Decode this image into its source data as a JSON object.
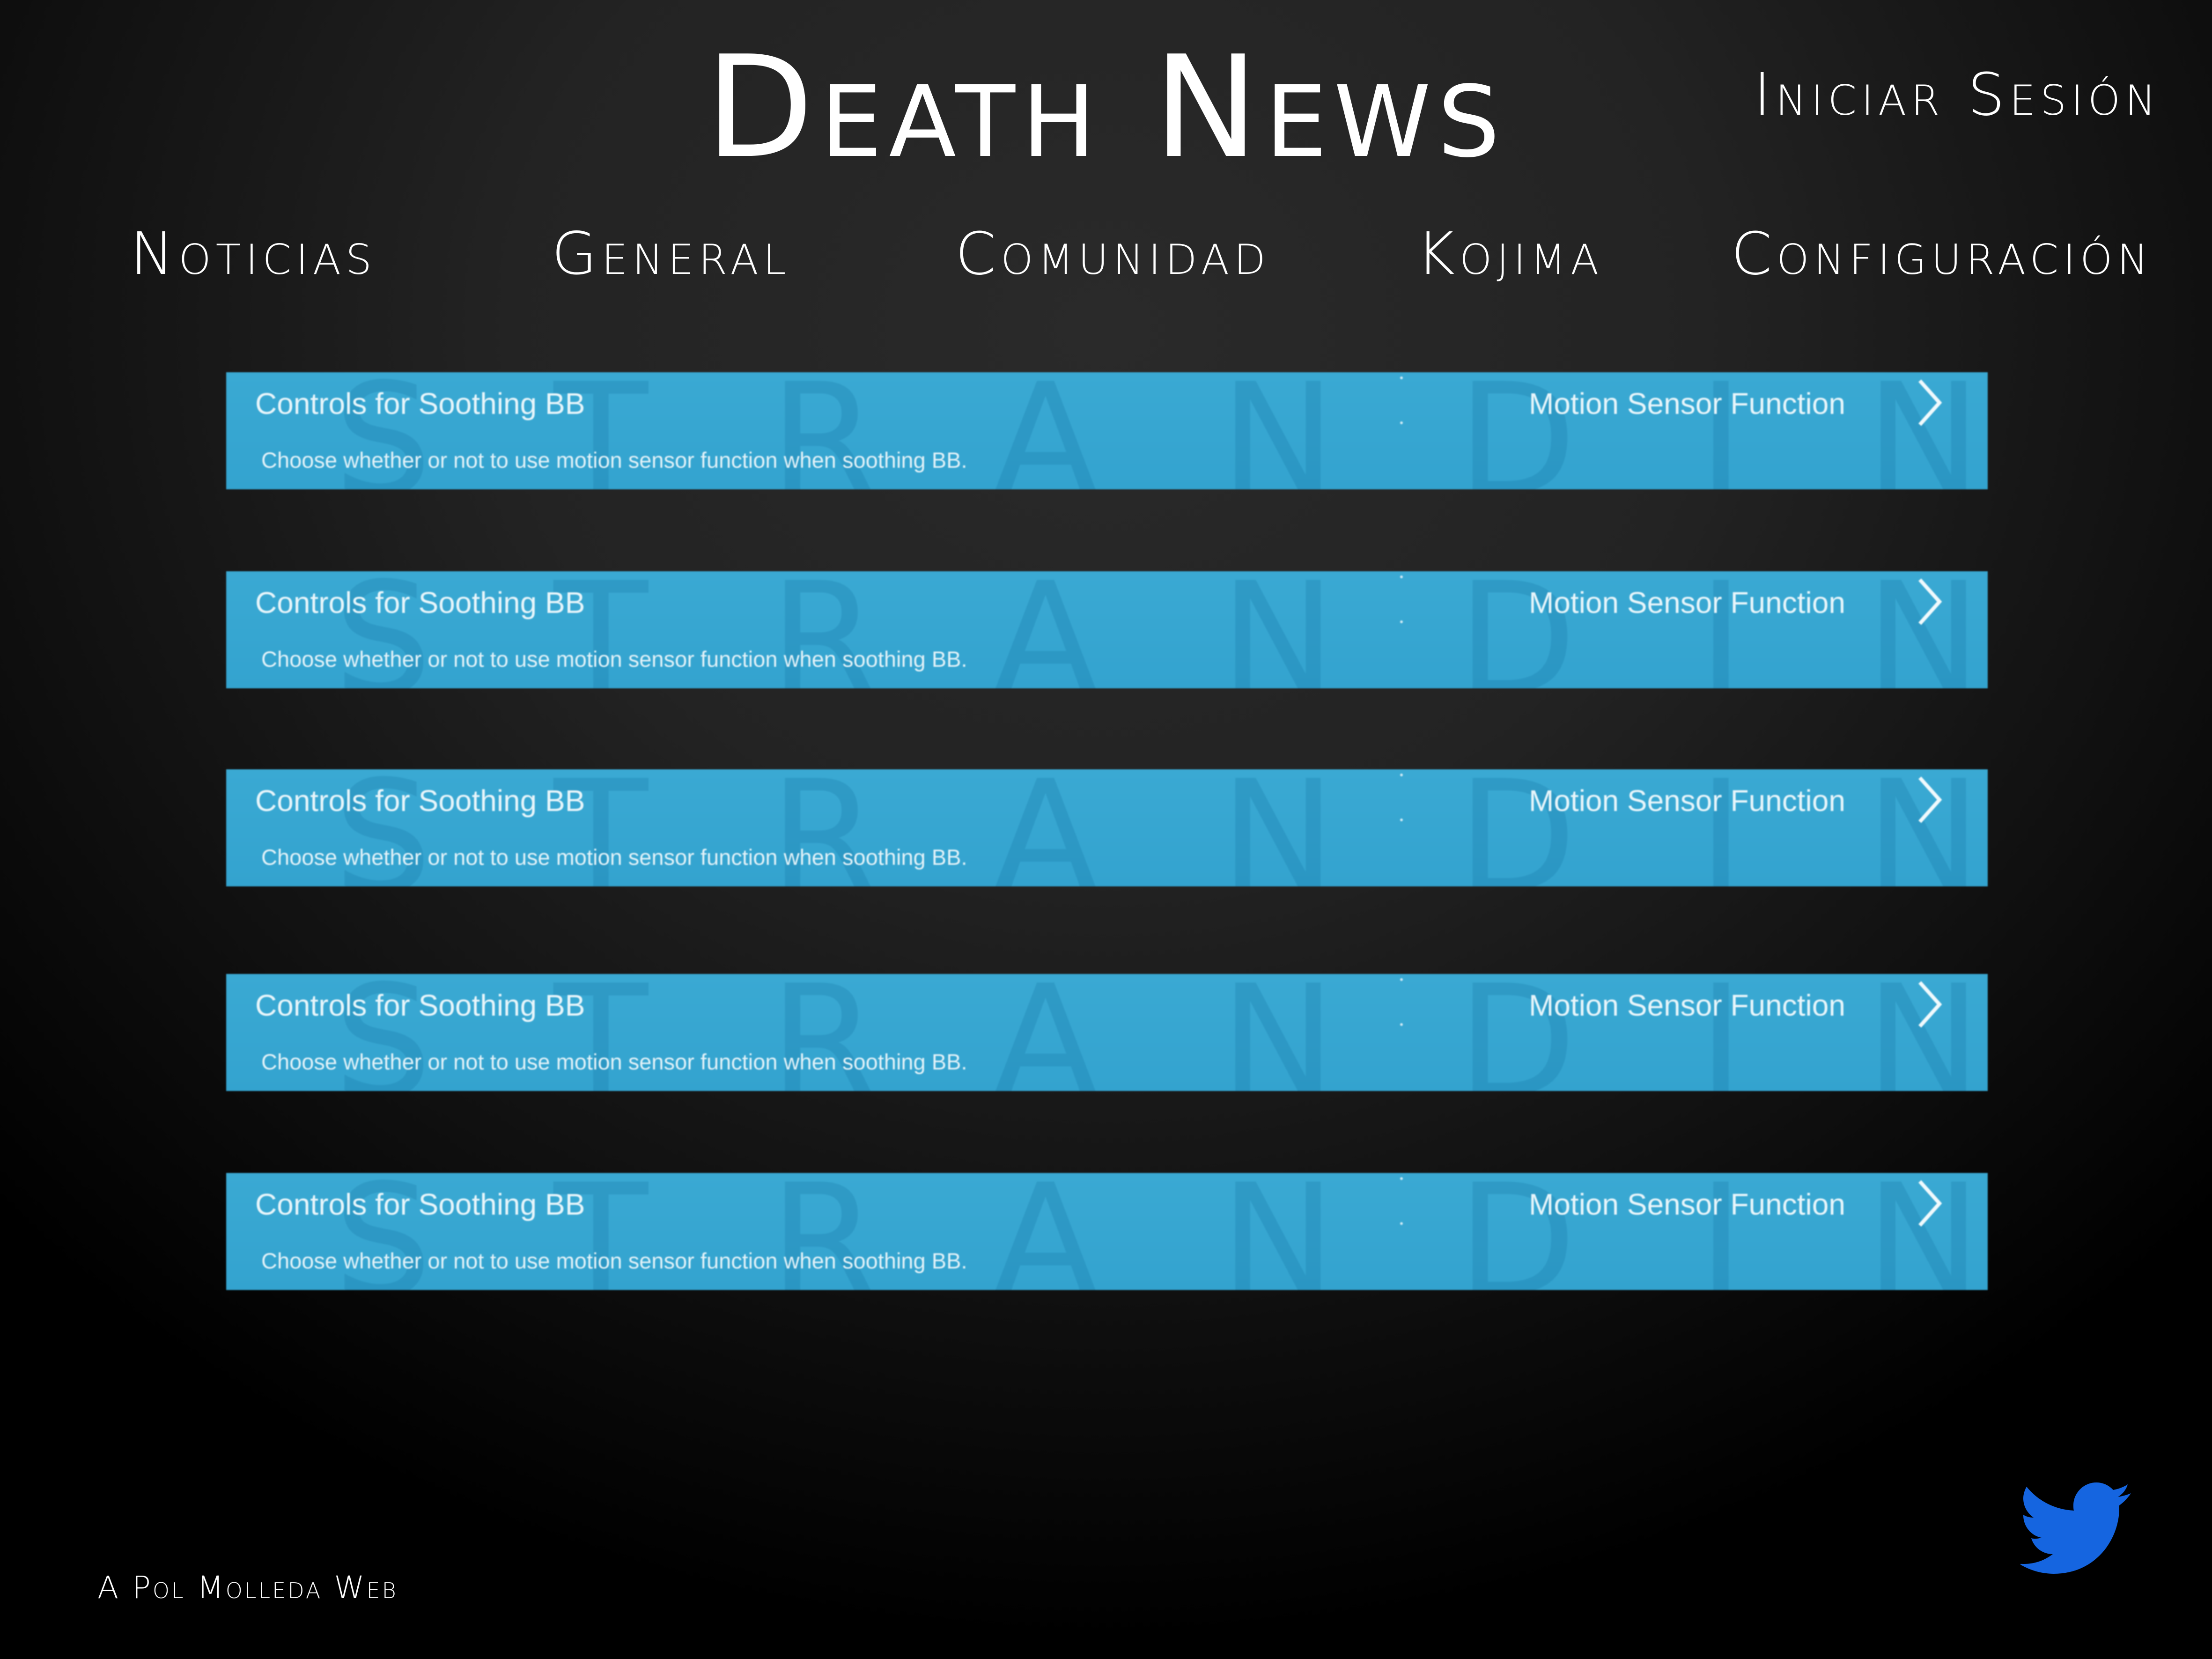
{
  "header": {
    "title": "Death News",
    "login_label": "Iniciar Sesión"
  },
  "nav": {
    "items": [
      {
        "label": "Noticias"
      },
      {
        "label": "General"
      },
      {
        "label": "Comunidad"
      },
      {
        "label": "Kojima"
      },
      {
        "label": "Configuración"
      }
    ]
  },
  "news": {
    "items": [
      {
        "title": "Controls for Soothing BB",
        "label": "Motion Sensor Function",
        "description": "Choose whether or not to use motion sensor function when soothing BB.",
        "watermark": "STRANDING"
      },
      {
        "title": "Controls for Soothing BB",
        "label": "Motion Sensor Function",
        "description": "Choose whether or not to use motion sensor function when soothing BB.",
        "watermark": "STRANDING"
      },
      {
        "title": "Controls for Soothing BB",
        "label": "Motion Sensor Function",
        "description": "Choose whether or not to use motion sensor function when soothing BB.",
        "watermark": "STRANDING"
      },
      {
        "title": "Controls for Soothing BB",
        "label": "Motion Sensor Function",
        "description": "Choose whether or not to use motion sensor function when soothing BB.",
        "watermark": "STRANDING"
      },
      {
        "title": "Controls for Soothing BB",
        "label": "Motion Sensor Function",
        "description": "Choose whether or not to use motion sensor function when soothing BB.",
        "watermark": "STRANDING"
      }
    ]
  },
  "footer": {
    "credit": "A Pol Molleda Web",
    "twitter_icon": "twitter-bird-icon"
  },
  "colors": {
    "card": "#36a6d1",
    "twitter": "#1565e0",
    "text": "#ffffff"
  }
}
